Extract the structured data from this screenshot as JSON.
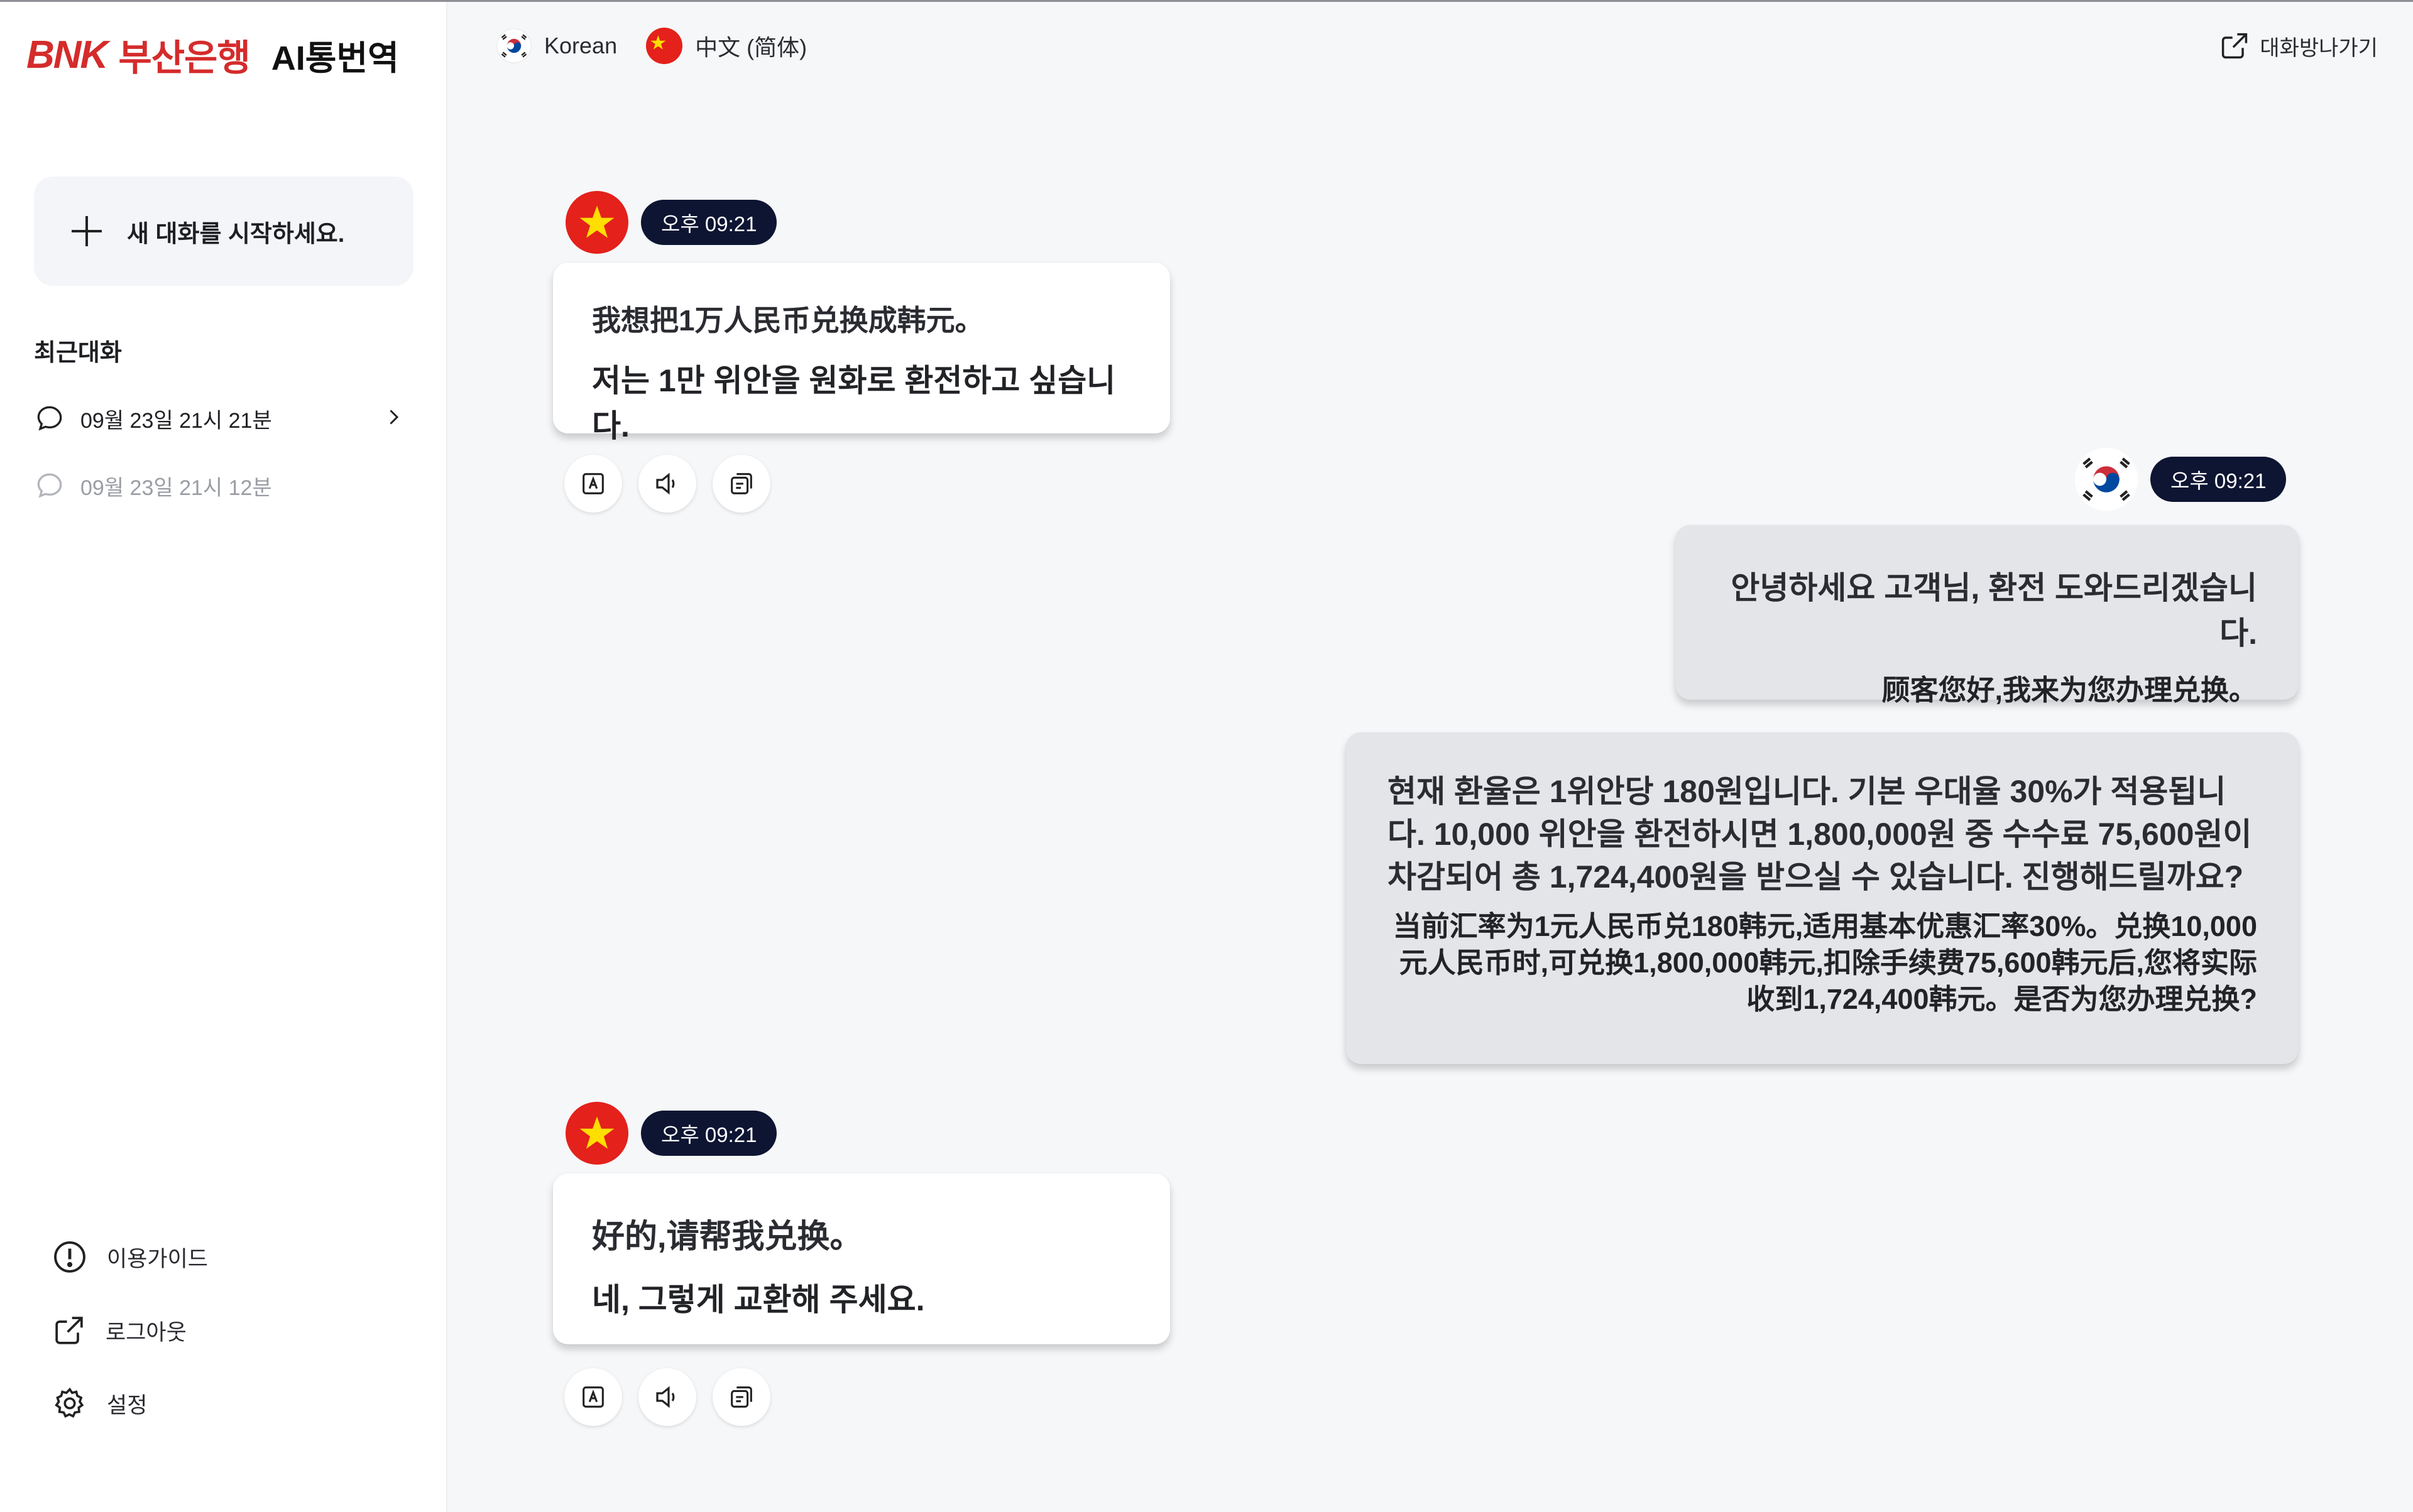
{
  "brand": {
    "bnk": "BNK",
    "bank": "부산은행",
    "product": "AI통번역"
  },
  "sidebar": {
    "new_chat_label": "새 대화를 시작하세요.",
    "recent_title": "최근대화",
    "recent_items": [
      {
        "label": "09월 23일 21시 21분"
      },
      {
        "label": "09월 23일 21시 12분"
      }
    ],
    "bottom": [
      {
        "label": "이용가이드"
      },
      {
        "label": "로그아웃"
      },
      {
        "label": "설정"
      }
    ]
  },
  "header": {
    "languages": [
      {
        "label": "Korean",
        "flag": "korea-flag-icon"
      },
      {
        "label": "中文 (简体)",
        "flag": "china-flag-icon"
      }
    ],
    "exit_label": "대화방나가기"
  },
  "colors": {
    "brand_red": "#d52b2b",
    "time_pill": "#0d1532",
    "flag_red": "#e4211b",
    "flag_star": "#ffde00"
  },
  "messages": [
    {
      "side": "left",
      "time": "오후 09:21",
      "line1": "我想把1万人民币兑换成韩元。",
      "line2": "저는 1만 위안을 원화로 환전하고 싶습니다."
    },
    {
      "side": "right",
      "time": "오후 09:21",
      "line1": "안녕하세요 고객님, 환전 도와드리겠습니다.",
      "line2": "顾客您好,我来为您办理兑换。"
    },
    {
      "side": "right",
      "line1": "현재 환율은 1위안당 180원입니다. 기본 우대율 30%가 적용됩니다. 10,000 위안을 환전하시면 1,800,000원 중 수수료 75,600원이 차감되어 총 1,724,400원을 받으실 수 있습니다. 진행해드릴까요?",
      "line2": "当前汇率为1元人民币兑180韩元,适用基本优惠汇率30%。兑换10,000元人民币时,可兑换1,800,000韩元,扣除手续费75,600韩元后,您将实际收到1,724,400韩元。是否为您办理兑换?"
    },
    {
      "side": "left",
      "time": "오후 09:21",
      "line1": "好的,请帮我兑换。",
      "line2": "네, 그렇게 교환해 주세요."
    }
  ],
  "actions": {
    "text": "A"
  }
}
